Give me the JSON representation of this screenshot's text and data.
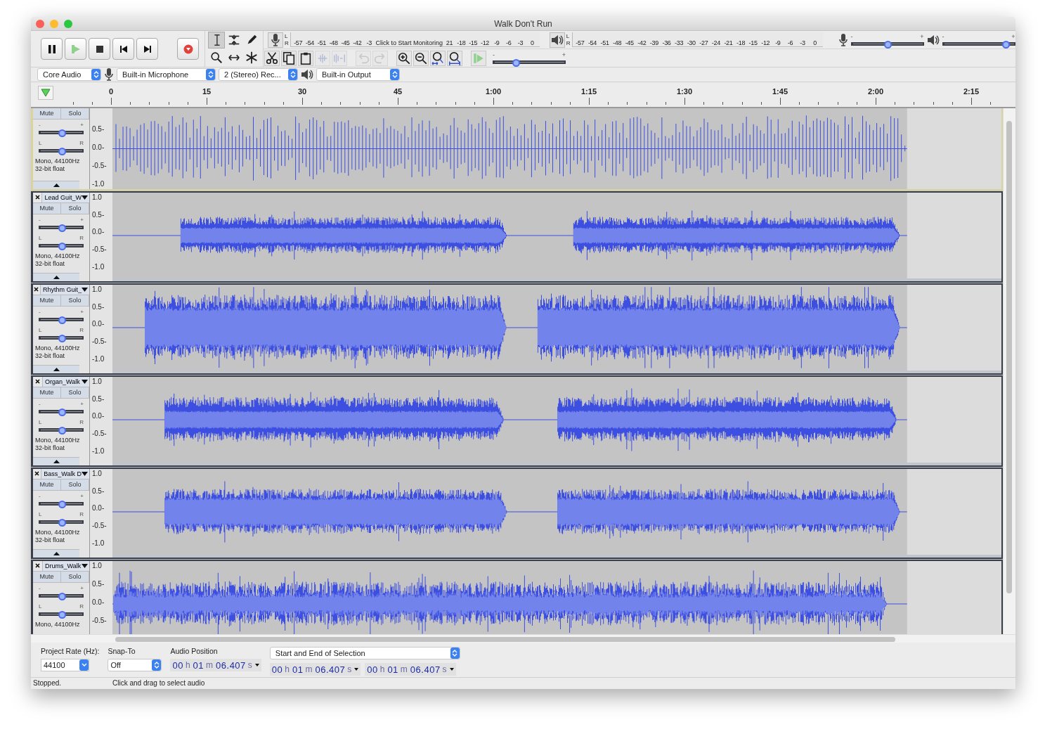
{
  "window": {
    "title": "Walk Don't Run"
  },
  "tools": [
    {
      "kind": "ibeam",
      "selected": true
    },
    {
      "kind": "envelope",
      "selected": false
    },
    {
      "kind": "pencil",
      "selected": false
    },
    {
      "kind": "zoom",
      "selected": false
    },
    {
      "kind": "timeshift",
      "selected": false
    },
    {
      "kind": "multi",
      "selected": false
    }
  ],
  "record_meter": {
    "channels": [
      "L",
      "R"
    ],
    "ticks_before": [
      "-57",
      "-54",
      "-51",
      "-48",
      "-45",
      "-42",
      "-3"
    ],
    "hint": "Click to Start Monitoring",
    "ticks_after": [
      "21",
      "-18",
      "-15",
      "-12",
      "-9",
      "-6",
      "-3",
      "0"
    ]
  },
  "playback_meter": {
    "channels": [
      "L",
      "R"
    ],
    "ticks": [
      "-57",
      "-54",
      "-51",
      "-48",
      "-45",
      "-42",
      "-39",
      "-36",
      "-33",
      "-30",
      "-27",
      "-24",
      "-21",
      "-18",
      "-15",
      "-12",
      "-9",
      "-6",
      "-3",
      "0"
    ]
  },
  "mixer": [
    {
      "kind": "mic",
      "min_label": "-",
      "max_label": "+",
      "level": 0.5
    },
    {
      "kind": "speaker",
      "min_label": "-",
      "max_label": "+",
      "level": 0.88
    }
  ],
  "edit_buttons": [
    {
      "kind": "cut",
      "disabled": false
    },
    {
      "kind": "copy",
      "disabled": false
    },
    {
      "kind": "paste",
      "disabled": false
    },
    {
      "kind": "trim",
      "disabled": true
    },
    {
      "kind": "silence",
      "disabled": true
    },
    {
      "kind": "undo",
      "disabled": true
    },
    {
      "kind": "redo",
      "disabled": true
    },
    {
      "kind": "zoom-in",
      "disabled": false
    },
    {
      "kind": "zoom-out",
      "disabled": false
    },
    {
      "kind": "fit-selection",
      "disabled": false
    },
    {
      "kind": "fit-project",
      "disabled": false
    }
  ],
  "play_at_speed": {
    "min_label": "-",
    "max_label": "+",
    "level": 0.3
  },
  "devices": {
    "host": "Core Audio",
    "recording_device": "Built-in Microphone",
    "channels": "2 (Stereo) Rec...",
    "playback_device": "Built-in Output"
  },
  "ruler": {
    "labels": [
      "0",
      "15",
      "30",
      "45",
      "1:00",
      "1:15",
      "1:30",
      "1:45",
      "2:00",
      "2:15"
    ]
  },
  "tracks": [
    {
      "focused": true,
      "mute": "Mute",
      "solo": "Solo",
      "gain_labels": [
        "-",
        "+"
      ],
      "gain": {
        "level": 0.5
      },
      "pan_labels": [
        "L",
        "R"
      ],
      "pan": {
        "level": 0.5
      },
      "info": [
        "Mono, 44100Hz",
        "32-bit float"
      ],
      "scale": [
        "0.5-",
        "0.0-",
        "-0.5-",
        "-1.0"
      ]
    },
    {
      "name": "Lead Guit_W",
      "focused": false,
      "mute": "Mute",
      "solo": "Solo",
      "gain_labels": [
        "-",
        "+"
      ],
      "gain": {
        "level": 0.5
      },
      "pan_labels": [
        "L",
        "R"
      ],
      "pan": {
        "level": 0.5
      },
      "info": [
        "Mono, 44100Hz",
        "32-bit float"
      ],
      "scale": [
        "1.0",
        "0.5-",
        "0.0-",
        "-0.5-",
        "-1.0"
      ]
    },
    {
      "name": "Rhythm Guit_",
      "focused": false,
      "mute": "Mute",
      "solo": "Solo",
      "gain_labels": [
        "-",
        "+"
      ],
      "gain": {
        "level": 0.5
      },
      "pan_labels": [
        "L",
        "R"
      ],
      "pan": {
        "level": 0.5
      },
      "info": [
        "Mono, 44100Hz",
        "32-bit float"
      ],
      "scale": [
        "1.0",
        "0.5-",
        "0.0-",
        "-0.5-",
        "-1.0"
      ]
    },
    {
      "name": "Organ_Walk",
      "focused": false,
      "mute": "Mute",
      "solo": "Solo",
      "gain_labels": [
        "-",
        "+"
      ],
      "gain": {
        "level": 0.5
      },
      "pan_labels": [
        "L",
        "R"
      ],
      "pan": {
        "level": 0.5
      },
      "info": [
        "Mono, 44100Hz",
        "32-bit float"
      ],
      "scale": [
        "1.0",
        "0.5-",
        "0.0-",
        "-0.5-",
        "-1.0"
      ]
    },
    {
      "name": "Bass_Walk D",
      "focused": false,
      "mute": "Mute",
      "solo": "Solo",
      "gain_labels": [
        "-",
        "+"
      ],
      "gain": {
        "level": 0.5
      },
      "pan_labels": [
        "L",
        "R"
      ],
      "pan": {
        "level": 0.5
      },
      "info": [
        "Mono, 44100Hz",
        "32-bit float"
      ],
      "scale": [
        "1.0",
        "0.5-",
        "0.0-",
        "-0.5-",
        "-1.0"
      ]
    },
    {
      "name": "Drums_Walk",
      "focused": false,
      "mute": "Mute",
      "solo": "Solo",
      "gain_labels": [
        "-",
        "+"
      ],
      "gain": {
        "level": 0.5
      },
      "pan_labels": [
        "L",
        "R"
      ],
      "pan": {
        "level": 0.5
      },
      "info": [
        "Mono, 44100Hz"
      ],
      "scale": [
        "1.0",
        "0.5-",
        "0.0-",
        "-0.5-"
      ]
    }
  ],
  "selection_toolbar": {
    "project_rate": {
      "label": "Project Rate (Hz):",
      "value": "44100"
    },
    "snap_to": {
      "label": "Snap-To",
      "value": "Off"
    },
    "audio_position": {
      "label": "Audio Position",
      "time": [
        {
          "value": "00",
          "unit": "h"
        },
        {
          "value": "01",
          "unit": "m"
        },
        {
          "value": "06.407",
          "unit": "s"
        }
      ]
    },
    "selection": {
      "mode": "Start and End of Selection",
      "start": [
        {
          "value": "00",
          "unit": "h"
        },
        {
          "value": "01",
          "unit": "m"
        },
        {
          "value": "06.407",
          "unit": "s"
        }
      ],
      "end": [
        {
          "value": "00",
          "unit": "h"
        },
        {
          "value": "01",
          "unit": "m"
        },
        {
          "value": "06.407",
          "unit": "s"
        }
      ]
    }
  },
  "status_bar": [
    "Stopped.",
    "Click and drag to select audio"
  ]
}
